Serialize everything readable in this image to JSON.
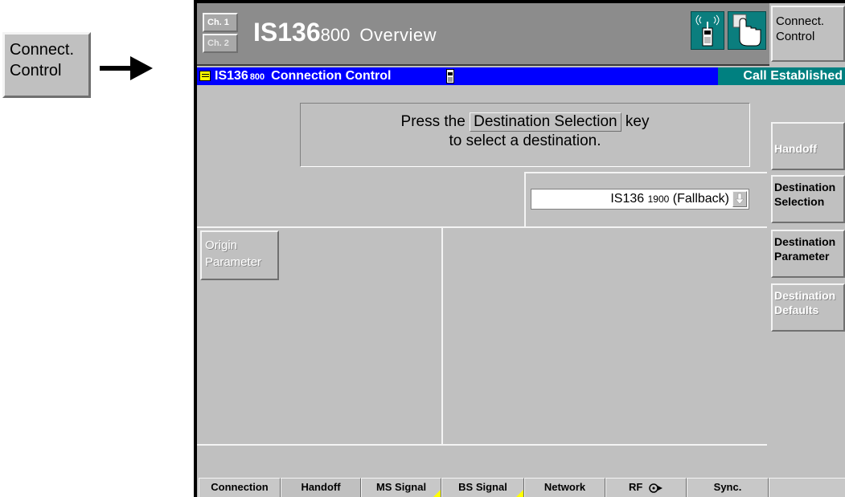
{
  "left_key": {
    "line1": "Connect.",
    "line2": "Control"
  },
  "header": {
    "ch1": "Ch. 1",
    "ch2": "Ch. 2",
    "title_main": "IS136",
    "title_sub": "800",
    "title_rest": "Overview",
    "right_key_line1": "Connect.",
    "right_key_line2": "Control"
  },
  "status_bar": {
    "title_main": "IS136",
    "title_sub": "800",
    "title_rest": "Connection Control",
    "state": "Call Established"
  },
  "prompt": {
    "prefix": "Press the",
    "key_label": "Destination Selection",
    "suffix": "key",
    "line2": "to select a destination."
  },
  "destination_select": {
    "main": "IS136",
    "sub": "1900",
    "rest": "(Fallback)"
  },
  "softkeys": [
    {
      "line1": "Handoff",
      "line2": ""
    },
    {
      "line1": "Destination",
      "line2": "Selection"
    },
    {
      "line1": "Destination",
      "line2": "Parameter"
    },
    {
      "line1": "Destination",
      "line2": "Defaults"
    }
  ],
  "origin_button": {
    "line1": "Origin",
    "line2": "Parameter"
  },
  "tabs": [
    "Connection",
    "Handoff",
    "MS Signal",
    "BS Signal",
    "Network",
    "RF",
    "Sync."
  ],
  "colors": {
    "status_bar_bg": "#0000ff",
    "status_state_bg": "#008080",
    "header_bg": "#8c8c8c",
    "panel_bg": "#c0c0c0",
    "marker_yellow": "#ffff00"
  }
}
